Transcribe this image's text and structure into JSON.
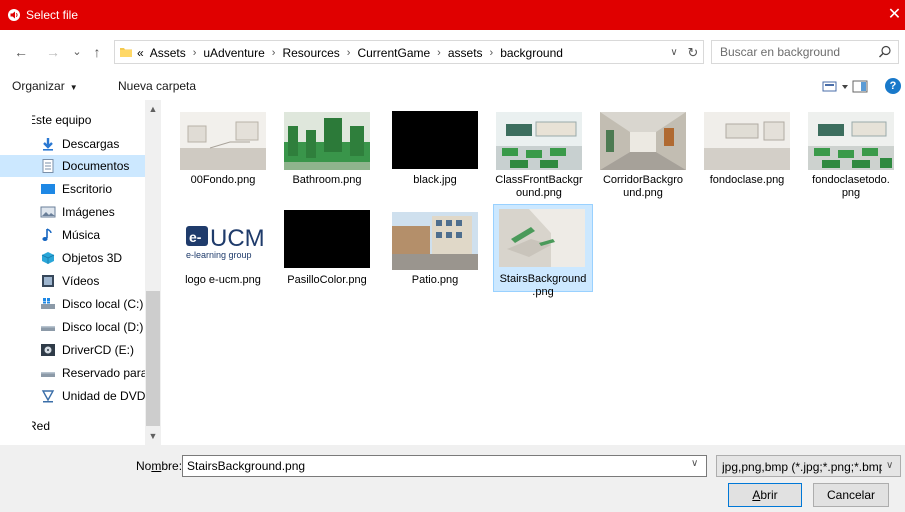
{
  "window": {
    "title": "Select file",
    "close_glyph": "✕",
    "app_icon": "speaker-icon"
  },
  "nav": {
    "back_glyph": "←",
    "forward_glyph": "→",
    "recent_glyph": "⌄",
    "up_glyph": "↑",
    "breadcrumb_prefix": "«",
    "breadcrumb": [
      "Assets",
      "uAdventure",
      "Resources",
      "CurrentGame",
      "assets",
      "background"
    ],
    "separator": "›",
    "dropdown_glyph": "∨",
    "refresh_glyph": "↻",
    "search_placeholder": "Buscar en background"
  },
  "toolbar": {
    "organize_label": "Organizar",
    "organize_caret": "▼",
    "new_folder_label": "Nueva carpeta",
    "help_glyph": "?"
  },
  "sidebar": {
    "items": [
      {
        "label": "Este equipo",
        "icon": "computer-icon"
      },
      {
        "label": "Descargas",
        "icon": "download-arrow-icon"
      },
      {
        "label": "Documentos",
        "icon": "document-icon",
        "selected": true
      },
      {
        "label": "Escritorio",
        "icon": "desktop-icon"
      },
      {
        "label": "Imágenes",
        "icon": "images-icon"
      },
      {
        "label": "Música",
        "icon": "music-note-icon"
      },
      {
        "label": "Objetos 3D",
        "icon": "cube-icon"
      },
      {
        "label": "Vídeos",
        "icon": "film-icon"
      },
      {
        "label": "Disco local (C:)",
        "icon": "windows-drive-icon"
      },
      {
        "label": "Disco local (D:)",
        "icon": "drive-icon"
      },
      {
        "label": "DriverCD (E:)",
        "icon": "cd-drive-icon"
      },
      {
        "label": "Reservado para el sistema",
        "icon": "drive-icon"
      },
      {
        "label": "Unidad de DVD (F:)",
        "icon": "dvd-drive-icon"
      },
      {
        "label": "Red",
        "icon": "network-icon"
      }
    ],
    "scroll_up_glyph": "▲",
    "scroll_down_glyph": "▼"
  },
  "files": [
    {
      "name": "00Fondo.png",
      "thumb": "gym-room"
    },
    {
      "name": "Bathroom.png",
      "thumb": "bathroom"
    },
    {
      "name": "black.jpg",
      "thumb": "black"
    },
    {
      "name": "ClassFrontBackground.png",
      "thumb": "classroom-front"
    },
    {
      "name": "CorridorBackground.png",
      "thumb": "corridor"
    },
    {
      "name": "fondoclase.png",
      "thumb": "empty-classroom"
    },
    {
      "name": "fondoclasetodo.png",
      "thumb": "classroom-full"
    },
    {
      "name": "logo e-ucm.png",
      "thumb": "logo"
    },
    {
      "name": "PasilloColor.png",
      "thumb": "black"
    },
    {
      "name": "Patio.png",
      "thumb": "patio"
    },
    {
      "name": "StairsBackground.png",
      "thumb": "stairs",
      "selected": true
    }
  ],
  "logo_text": {
    "mark": "e-",
    "big": "UCM",
    "small": "e-learning group"
  },
  "bottom": {
    "filename_label_pre": "No",
    "filename_label_accel": "m",
    "filename_label_post": "bre:",
    "filename_value": "StairsBackground.png",
    "filename_dropdown_glyph": "∨",
    "filter_value": "jpg,png,bmp (*.jpg;*.png;*.bmp)",
    "filter_dropdown_glyph": "∨",
    "open_accel": "A",
    "open_rest": "brir",
    "cancel_label": "Cancelar"
  },
  "colors": {
    "titlebar": "#e00000",
    "selection": "#cce8ff",
    "selection_border": "#99d1ff",
    "accent": "#0078d7"
  }
}
